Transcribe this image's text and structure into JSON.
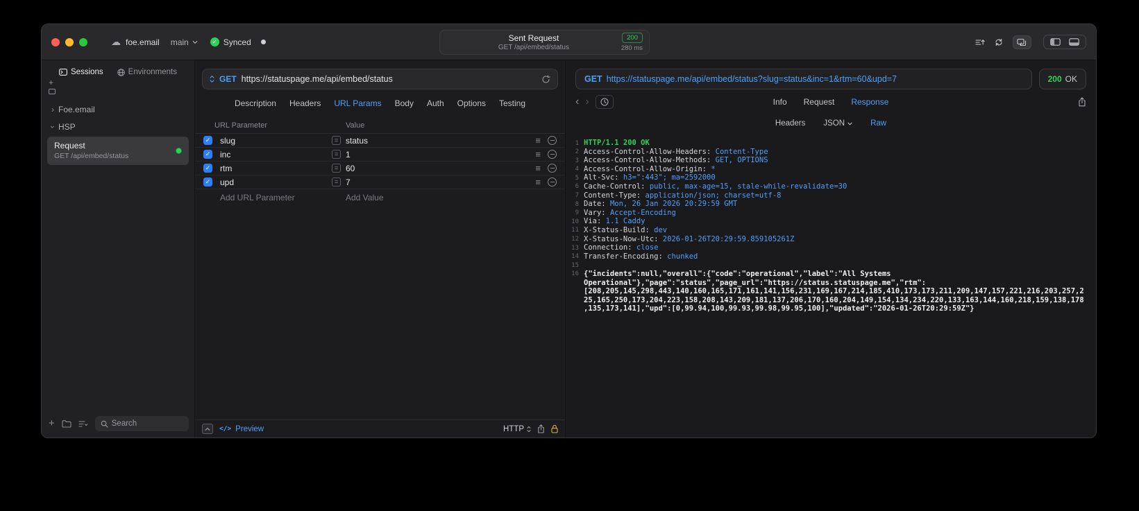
{
  "colors": {
    "accent_blue": "#4f9ff8",
    "success_green": "#30d158",
    "checkbox_blue": "#2d7ff7"
  },
  "titlebar": {
    "project": "foe.email",
    "branch": "main",
    "sync_status": "Synced",
    "request_summary": {
      "title": "Sent Request",
      "method_path": "GET /api/embed/status",
      "status_code": "200",
      "duration": "280 ms"
    }
  },
  "sidebar": {
    "tabs": [
      {
        "label": "Sessions"
      },
      {
        "label": "Environments"
      }
    ],
    "tree": {
      "group1": "Foe.email",
      "group2": "HSP",
      "request": {
        "title": "Request",
        "subtitle": "GET /api/embed/status"
      }
    },
    "search_placeholder": "Search"
  },
  "request_panel": {
    "method": "GET",
    "url": "https://statuspage.me/api/embed/status",
    "tabs": [
      "Description",
      "Headers",
      "URL Params",
      "Body",
      "Auth",
      "Options",
      "Testing"
    ],
    "active_tab": "URL Params",
    "table": {
      "columns": [
        "URL Parameter",
        "Value"
      ],
      "rows": [
        {
          "name": "slug",
          "value": "status"
        },
        {
          "name": "inc",
          "value": "1"
        },
        {
          "name": "rtm",
          "value": "60"
        },
        {
          "name": "upd",
          "value": "7"
        }
      ],
      "add_param_label": "Add URL Parameter",
      "add_value_label": "Add Value"
    },
    "footer": {
      "preview_label": "Preview",
      "protocol": "HTTP"
    }
  },
  "response_panel": {
    "method": "GET",
    "request_url": "https://statuspage.me/api/embed/status?slug=status&inc=1&rtm=60&upd=7",
    "status_code": "200",
    "status_text": "OK",
    "tabs": [
      "Info",
      "Request",
      "Response"
    ],
    "active_tab": "Response",
    "subtabs": [
      "Headers",
      "JSON",
      "Raw"
    ],
    "active_subtab": "Raw",
    "status_line": "HTTP/1.1 200 OK",
    "headers": [
      {
        "name": "Access-Control-Allow-Headers",
        "value": "Content-Type"
      },
      {
        "name": "Access-Control-Allow-Methods",
        "value": "GET, OPTIONS"
      },
      {
        "name": "Access-Control-Allow-Origin",
        "value": "*"
      },
      {
        "name": "Alt-Svc",
        "value": "h3=\":443\"; ma=2592000"
      },
      {
        "name": "Cache-Control",
        "value": "public, max-age=15, stale-while-revalidate=30"
      },
      {
        "name": "Content-Type",
        "value": "application/json; charset=utf-8"
      },
      {
        "name": "Date",
        "value": "Mon, 26 Jan 2026 20:29:59 GMT"
      },
      {
        "name": "Vary",
        "value": "Accept-Encoding"
      },
      {
        "name": "Via",
        "value": "1.1 Caddy"
      },
      {
        "name": "X-Status-Build",
        "value": "dev"
      },
      {
        "name": "X-Status-Now-Utc",
        "value": "2026-01-26T20:29:59.859105261Z"
      },
      {
        "name": "Connection",
        "value": "close"
      },
      {
        "name": "Transfer-Encoding",
        "value": "chunked"
      }
    ],
    "body": "{\"incidents\":null,\"overall\":{\"code\":\"operational\",\"label\":\"All Systems Operational\"},\"page\":\"status\",\"page_url\":\"https://status.statuspage.me\",\"rtm\":[208,205,145,298,443,140,160,165,171,161,141,156,231,169,167,214,185,410,173,173,211,209,147,157,221,216,203,257,225,165,250,173,204,223,158,208,143,209,181,137,206,170,160,204,149,154,134,234,220,133,163,144,160,218,159,138,178,135,173,141],\"upd\":[0,99.94,100,99.93,99.98,99.95,100],\"updated\":\"2026-01-26T20:29:59Z\"}"
  }
}
